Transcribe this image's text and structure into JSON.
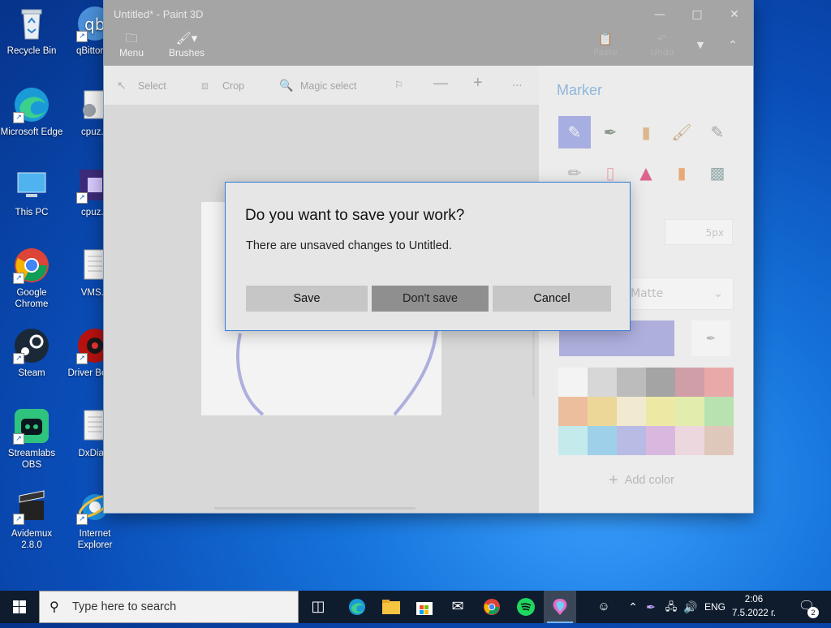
{
  "desktop": {
    "icons": [
      {
        "label": "Recycle Bin",
        "icon": "recycle-bin-icon"
      },
      {
        "label": "qBittorr...",
        "icon": "qbittorrent-icon"
      },
      {
        "label": "Microsoft Edge",
        "icon": "edge-icon"
      },
      {
        "label": "cpuz...",
        "icon": "cpuz-installer-icon"
      },
      {
        "label": "This PC",
        "icon": "this-pc-icon"
      },
      {
        "label": "cpuz...",
        "icon": "cpuz-icon"
      },
      {
        "label": "Google Chrome",
        "icon": "chrome-icon"
      },
      {
        "label": "VMS...",
        "icon": "text-file-icon"
      },
      {
        "label": "Steam",
        "icon": "steam-icon"
      },
      {
        "label": "Driver Bo... 9",
        "icon": "driver-booster-icon"
      },
      {
        "label": "Streamlabs OBS",
        "icon": "streamlabs-icon"
      },
      {
        "label": "DxDia...",
        "icon": "text-file-icon"
      },
      {
        "label": "Avidemux 2.8.0",
        "icon": "avidemux-icon"
      },
      {
        "label": "Internet Explorer",
        "icon": "ie-icon"
      }
    ]
  },
  "window": {
    "title": "Untitled* - Paint 3D",
    "menu_label": "Menu",
    "brushes_label": "Brushes",
    "paste_label": "Paste",
    "undo_label": "Undo"
  },
  "toolbar": {
    "select_label": "Select",
    "crop_label": "Crop",
    "magic_select_label": "Magic select"
  },
  "panel": {
    "title": "Marker",
    "thickness_value": "5px",
    "finish_value": "Matte",
    "current_color": "#a7a8e3",
    "add_color_label": "Add color",
    "palette": [
      "#ffffff",
      "#dcdcdc",
      "#b9b9b9",
      "#9a9a9a",
      "#d3939e",
      "#f2a1a1",
      "#f7bb91",
      "#f7dc8c",
      "#fdf3d3",
      "#f8f39b",
      "#e9f6a6",
      "#b4eaa8",
      "#c4f4f6",
      "#93d2f2",
      "#b4b8ec",
      "#deb4e6",
      "#f8dbe5",
      "#e6c8b8"
    ]
  },
  "dialog": {
    "title": "Do you want to save your work?",
    "message": "There are unsaved changes to Untitled.",
    "save_label": "Save",
    "dont_save_label": "Don't save",
    "cancel_label": "Cancel"
  },
  "taskbar": {
    "search_placeholder": "Type here to search",
    "language": "ENG",
    "time": "2:06",
    "date": "7.5.2022 г.",
    "notification_count": "2"
  }
}
